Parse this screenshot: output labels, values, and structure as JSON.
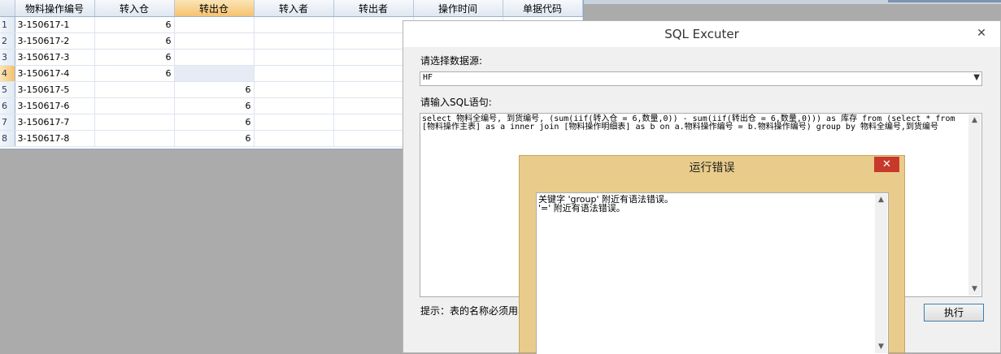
{
  "grid": {
    "columns": [
      "物料操作编号",
      "转入仓",
      "转出仓",
      "转入者",
      "转出者",
      "操作时间",
      "单据代码"
    ],
    "rows": [
      {
        "n": "1",
        "code": "3-150617-1",
        "in": "6",
        "out": ""
      },
      {
        "n": "2",
        "code": "3-150617-2",
        "in": "6",
        "out": ""
      },
      {
        "n": "3",
        "code": "3-150617-3",
        "in": "6",
        "out": ""
      },
      {
        "n": "4",
        "code": "3-150617-4",
        "in": "6",
        "out": ""
      },
      {
        "n": "5",
        "code": "3-150617-5",
        "in": "",
        "out": "6"
      },
      {
        "n": "6",
        "code": "3-150617-6",
        "in": "",
        "out": "6"
      },
      {
        "n": "7",
        "code": "3-150617-7",
        "in": "",
        "out": "6"
      },
      {
        "n": "8",
        "code": "3-150617-8",
        "in": "",
        "out": "6"
      }
    ]
  },
  "sql_window": {
    "title": "SQL Excuter",
    "close_glyph": "✕",
    "datasource_label": "请选择数据源:",
    "datasource_value": "HF",
    "sql_label": "请输入SQL语句:",
    "sql_text": "select 物料全编号, 到货编号, (sum(iif(转入仓 = 6,数量,0)) - sum(iif(转出仓 = 6,数量,0))) as 库存 from (select * from [物料操作主表] as a inner join [物料操作明细表] as b on a.物料操作编号 = b.物料操作编号) group by 物料全编号,到货编号",
    "hint": "提示：表的名称必须用",
    "execute_label": "执行"
  },
  "error_dialog": {
    "title": "运行错误",
    "close_glyph": "✕",
    "message": "关键字 'group' 附近有语法错误。\n'=' 附近有语法错误。"
  },
  "colors": {
    "header_selected": "#f5c26f",
    "error_close": "#c7392b",
    "error_frame": "#e9cc8b"
  }
}
